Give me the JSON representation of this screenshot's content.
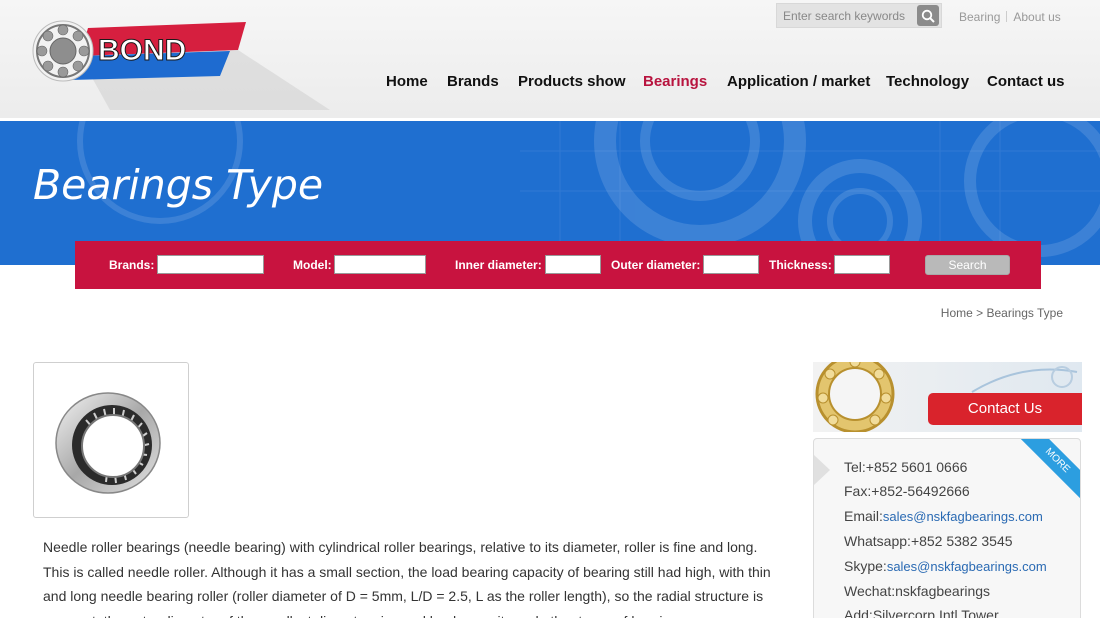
{
  "header": {
    "logo_text": "BOND",
    "search": {
      "placeholder": "Enter search keywords",
      "value": ""
    },
    "top_links": [
      "Bearing",
      "About us"
    ],
    "nav": [
      {
        "label": "Home",
        "active": false
      },
      {
        "label": "Brands",
        "active": false
      },
      {
        "label": "Products show",
        "active": false
      },
      {
        "label": "Bearings",
        "active": true
      },
      {
        "label": "Application / market",
        "active": false
      },
      {
        "label": "Technology",
        "active": false
      },
      {
        "label": "Contact us",
        "active": false
      }
    ]
  },
  "banner": {
    "title": "Bearings Type"
  },
  "filter": {
    "brands_label": "Brands:",
    "model_label": "Model:",
    "inner_label": "Inner diameter:",
    "outer_label": "Outer diameter:",
    "thickness_label": "Thickness:",
    "search_button": "Search",
    "values": {
      "brands": "",
      "model": "",
      "inner": "",
      "outer": "",
      "thickness": ""
    }
  },
  "breadcrumb": {
    "home": "Home",
    "separator": ">",
    "current": "Bearings Type"
  },
  "product": {
    "image_icon": "needle-roller-bearing-image",
    "description": "Needle roller bearings (needle bearing) with cylindrical roller bearings, relative to its diameter, roller is fine and long. This is called needle roller. Although it has a small section, the load bearing capacity of bearing still had high, with thin and long needle bearing roller (roller diameter of D = 5mm, L/D = 2.5, L as the roller length), so the radial structure is compact, the outer diameter of the smallest diameter size and load capacity and other types of bearings"
  },
  "sidebar": {
    "contact_button": "Contact Us",
    "ribbon": "MORE",
    "contact": {
      "tel_label": "Tel:",
      "tel": "+852 5601 0666",
      "fax_label": "Fax:",
      "fax": "+852-56492666",
      "email_label": "Email:",
      "email": "sales@nskfagbearings.com",
      "whatsapp_label": "Whatsapp:",
      "whatsapp": "+852 5382 3545",
      "skype_label": "Skype:",
      "skype": "sales@nskfagbearings.com",
      "wechat_label": "Wechat:",
      "wechat": "nskfagbearings",
      "address_label": "Add:",
      "address": "Silvercorp Intl Tower,"
    }
  },
  "colors": {
    "brand_red": "#c8133f",
    "nav_active": "#b8143f",
    "banner_blue": "#1f6fd0",
    "contact_red": "#d9232c",
    "link_blue": "#2a6ab3"
  }
}
